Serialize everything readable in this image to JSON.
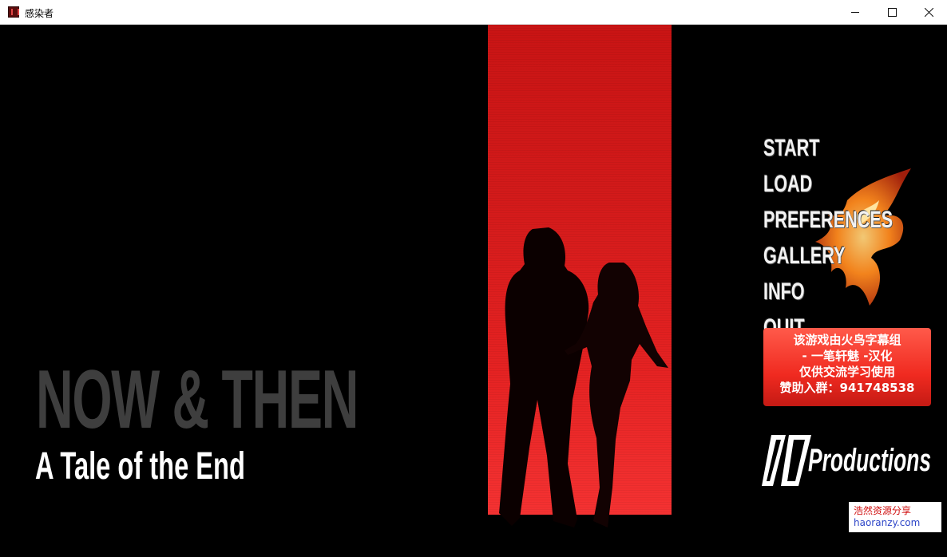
{
  "window": {
    "title": "感染者",
    "icons": {
      "app": "app-icon",
      "minimize": "minimize-icon",
      "maximize": "maximize-icon",
      "close": "close-icon"
    }
  },
  "game": {
    "title_main": "NOW & THEN",
    "title_sub": "A Tale of the End",
    "menu": [
      {
        "id": "start",
        "label": "START"
      },
      {
        "id": "load",
        "label": "LOAD"
      },
      {
        "id": "preferences",
        "label": "PREFERENCES"
      },
      {
        "id": "gallery",
        "label": "GALLERY"
      },
      {
        "id": "info",
        "label": "INFO"
      },
      {
        "id": "quit",
        "label": "QUIT"
      }
    ],
    "credits": [
      "该游戏由火鸟字幕组",
      "- 一笔轩魅 -汉化",
      "仅供交流学习使用",
      "赞助入群：941748538"
    ],
    "logo": {
      "mark": "ILS",
      "text": "Productions"
    },
    "colors": {
      "accent_red": "#e52222",
      "title_grey": "#3e3e3e",
      "menu_white": "#f2f2f2"
    }
  },
  "watermark": {
    "line1": "浩然资源分享",
    "line2": "haoranzy.com"
  }
}
